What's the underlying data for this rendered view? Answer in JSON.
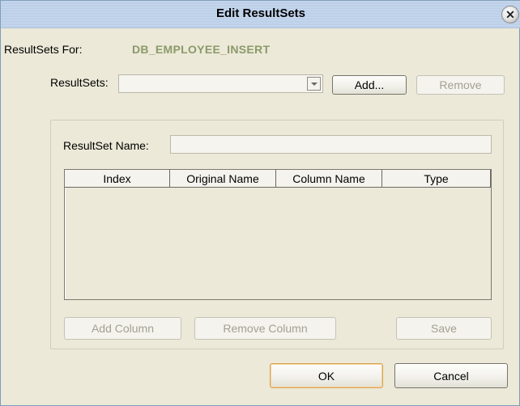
{
  "window": {
    "title": "Edit ResultSets",
    "close_symbol": "✕"
  },
  "header": {
    "resultsets_for_label": "ResultSets For:",
    "resultsets_for_value": "DB_EMPLOYEE_INSERT"
  },
  "resultsets": {
    "label": "ResultSets:",
    "selected": "",
    "add_label": "Add...",
    "remove_label": "Remove"
  },
  "group": {
    "name_label": "ResultSet Name:",
    "name_value": "",
    "columns": [
      "Index",
      "Original Name",
      "Column Name",
      "Type"
    ],
    "rows": [],
    "add_column_label": "Add Column",
    "remove_column_label": "Remove Column",
    "save_label": "Save"
  },
  "footer": {
    "ok_label": "OK",
    "cancel_label": "Cancel"
  },
  "icons": {
    "dropdown": "chevron-down-icon",
    "close": "close-icon"
  }
}
